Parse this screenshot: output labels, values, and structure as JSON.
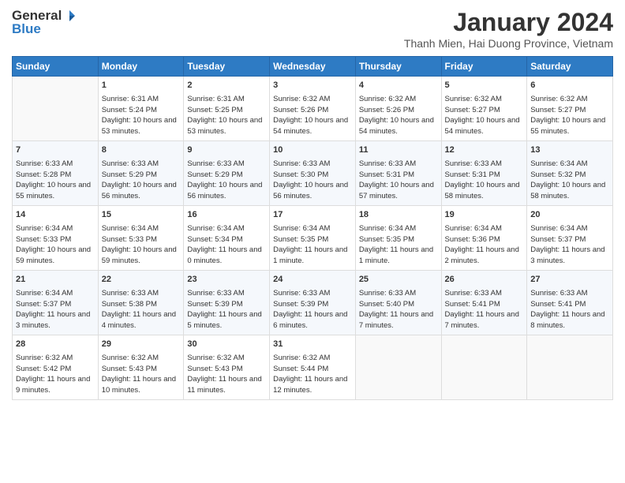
{
  "header": {
    "logo_general": "General",
    "logo_blue": "Blue",
    "month_title": "January 2024",
    "location": "Thanh Mien, Hai Duong Province, Vietnam"
  },
  "days": [
    "Sunday",
    "Monday",
    "Tuesday",
    "Wednesday",
    "Thursday",
    "Friday",
    "Saturday"
  ],
  "weeks": [
    [
      {
        "day": "",
        "sunrise": "",
        "sunset": "",
        "daylight": ""
      },
      {
        "day": "1",
        "sunrise": "Sunrise: 6:31 AM",
        "sunset": "Sunset: 5:24 PM",
        "daylight": "Daylight: 10 hours and 53 minutes."
      },
      {
        "day": "2",
        "sunrise": "Sunrise: 6:31 AM",
        "sunset": "Sunset: 5:25 PM",
        "daylight": "Daylight: 10 hours and 53 minutes."
      },
      {
        "day": "3",
        "sunrise": "Sunrise: 6:32 AM",
        "sunset": "Sunset: 5:26 PM",
        "daylight": "Daylight: 10 hours and 54 minutes."
      },
      {
        "day": "4",
        "sunrise": "Sunrise: 6:32 AM",
        "sunset": "Sunset: 5:26 PM",
        "daylight": "Daylight: 10 hours and 54 minutes."
      },
      {
        "day": "5",
        "sunrise": "Sunrise: 6:32 AM",
        "sunset": "Sunset: 5:27 PM",
        "daylight": "Daylight: 10 hours and 54 minutes."
      },
      {
        "day": "6",
        "sunrise": "Sunrise: 6:32 AM",
        "sunset": "Sunset: 5:27 PM",
        "daylight": "Daylight: 10 hours and 55 minutes."
      }
    ],
    [
      {
        "day": "7",
        "sunrise": "Sunrise: 6:33 AM",
        "sunset": "Sunset: 5:28 PM",
        "daylight": "Daylight: 10 hours and 55 minutes."
      },
      {
        "day": "8",
        "sunrise": "Sunrise: 6:33 AM",
        "sunset": "Sunset: 5:29 PM",
        "daylight": "Daylight: 10 hours and 56 minutes."
      },
      {
        "day": "9",
        "sunrise": "Sunrise: 6:33 AM",
        "sunset": "Sunset: 5:29 PM",
        "daylight": "Daylight: 10 hours and 56 minutes."
      },
      {
        "day": "10",
        "sunrise": "Sunrise: 6:33 AM",
        "sunset": "Sunset: 5:30 PM",
        "daylight": "Daylight: 10 hours and 56 minutes."
      },
      {
        "day": "11",
        "sunrise": "Sunrise: 6:33 AM",
        "sunset": "Sunset: 5:31 PM",
        "daylight": "Daylight: 10 hours and 57 minutes."
      },
      {
        "day": "12",
        "sunrise": "Sunrise: 6:33 AM",
        "sunset": "Sunset: 5:31 PM",
        "daylight": "Daylight: 10 hours and 58 minutes."
      },
      {
        "day": "13",
        "sunrise": "Sunrise: 6:34 AM",
        "sunset": "Sunset: 5:32 PM",
        "daylight": "Daylight: 10 hours and 58 minutes."
      }
    ],
    [
      {
        "day": "14",
        "sunrise": "Sunrise: 6:34 AM",
        "sunset": "Sunset: 5:33 PM",
        "daylight": "Daylight: 10 hours and 59 minutes."
      },
      {
        "day": "15",
        "sunrise": "Sunrise: 6:34 AM",
        "sunset": "Sunset: 5:33 PM",
        "daylight": "Daylight: 10 hours and 59 minutes."
      },
      {
        "day": "16",
        "sunrise": "Sunrise: 6:34 AM",
        "sunset": "Sunset: 5:34 PM",
        "daylight": "Daylight: 11 hours and 0 minutes."
      },
      {
        "day": "17",
        "sunrise": "Sunrise: 6:34 AM",
        "sunset": "Sunset: 5:35 PM",
        "daylight": "Daylight: 11 hours and 1 minute."
      },
      {
        "day": "18",
        "sunrise": "Sunrise: 6:34 AM",
        "sunset": "Sunset: 5:35 PM",
        "daylight": "Daylight: 11 hours and 1 minute."
      },
      {
        "day": "19",
        "sunrise": "Sunrise: 6:34 AM",
        "sunset": "Sunset: 5:36 PM",
        "daylight": "Daylight: 11 hours and 2 minutes."
      },
      {
        "day": "20",
        "sunrise": "Sunrise: 6:34 AM",
        "sunset": "Sunset: 5:37 PM",
        "daylight": "Daylight: 11 hours and 3 minutes."
      }
    ],
    [
      {
        "day": "21",
        "sunrise": "Sunrise: 6:34 AM",
        "sunset": "Sunset: 5:37 PM",
        "daylight": "Daylight: 11 hours and 3 minutes."
      },
      {
        "day": "22",
        "sunrise": "Sunrise: 6:33 AM",
        "sunset": "Sunset: 5:38 PM",
        "daylight": "Daylight: 11 hours and 4 minutes."
      },
      {
        "day": "23",
        "sunrise": "Sunrise: 6:33 AM",
        "sunset": "Sunset: 5:39 PM",
        "daylight": "Daylight: 11 hours and 5 minutes."
      },
      {
        "day": "24",
        "sunrise": "Sunrise: 6:33 AM",
        "sunset": "Sunset: 5:39 PM",
        "daylight": "Daylight: 11 hours and 6 minutes."
      },
      {
        "day": "25",
        "sunrise": "Sunrise: 6:33 AM",
        "sunset": "Sunset: 5:40 PM",
        "daylight": "Daylight: 11 hours and 7 minutes."
      },
      {
        "day": "26",
        "sunrise": "Sunrise: 6:33 AM",
        "sunset": "Sunset: 5:41 PM",
        "daylight": "Daylight: 11 hours and 7 minutes."
      },
      {
        "day": "27",
        "sunrise": "Sunrise: 6:33 AM",
        "sunset": "Sunset: 5:41 PM",
        "daylight": "Daylight: 11 hours and 8 minutes."
      }
    ],
    [
      {
        "day": "28",
        "sunrise": "Sunrise: 6:32 AM",
        "sunset": "Sunset: 5:42 PM",
        "daylight": "Daylight: 11 hours and 9 minutes."
      },
      {
        "day": "29",
        "sunrise": "Sunrise: 6:32 AM",
        "sunset": "Sunset: 5:43 PM",
        "daylight": "Daylight: 11 hours and 10 minutes."
      },
      {
        "day": "30",
        "sunrise": "Sunrise: 6:32 AM",
        "sunset": "Sunset: 5:43 PM",
        "daylight": "Daylight: 11 hours and 11 minutes."
      },
      {
        "day": "31",
        "sunrise": "Sunrise: 6:32 AM",
        "sunset": "Sunset: 5:44 PM",
        "daylight": "Daylight: 11 hours and 12 minutes."
      },
      {
        "day": "",
        "sunrise": "",
        "sunset": "",
        "daylight": ""
      },
      {
        "day": "",
        "sunrise": "",
        "sunset": "",
        "daylight": ""
      },
      {
        "day": "",
        "sunrise": "",
        "sunset": "",
        "daylight": ""
      }
    ]
  ]
}
